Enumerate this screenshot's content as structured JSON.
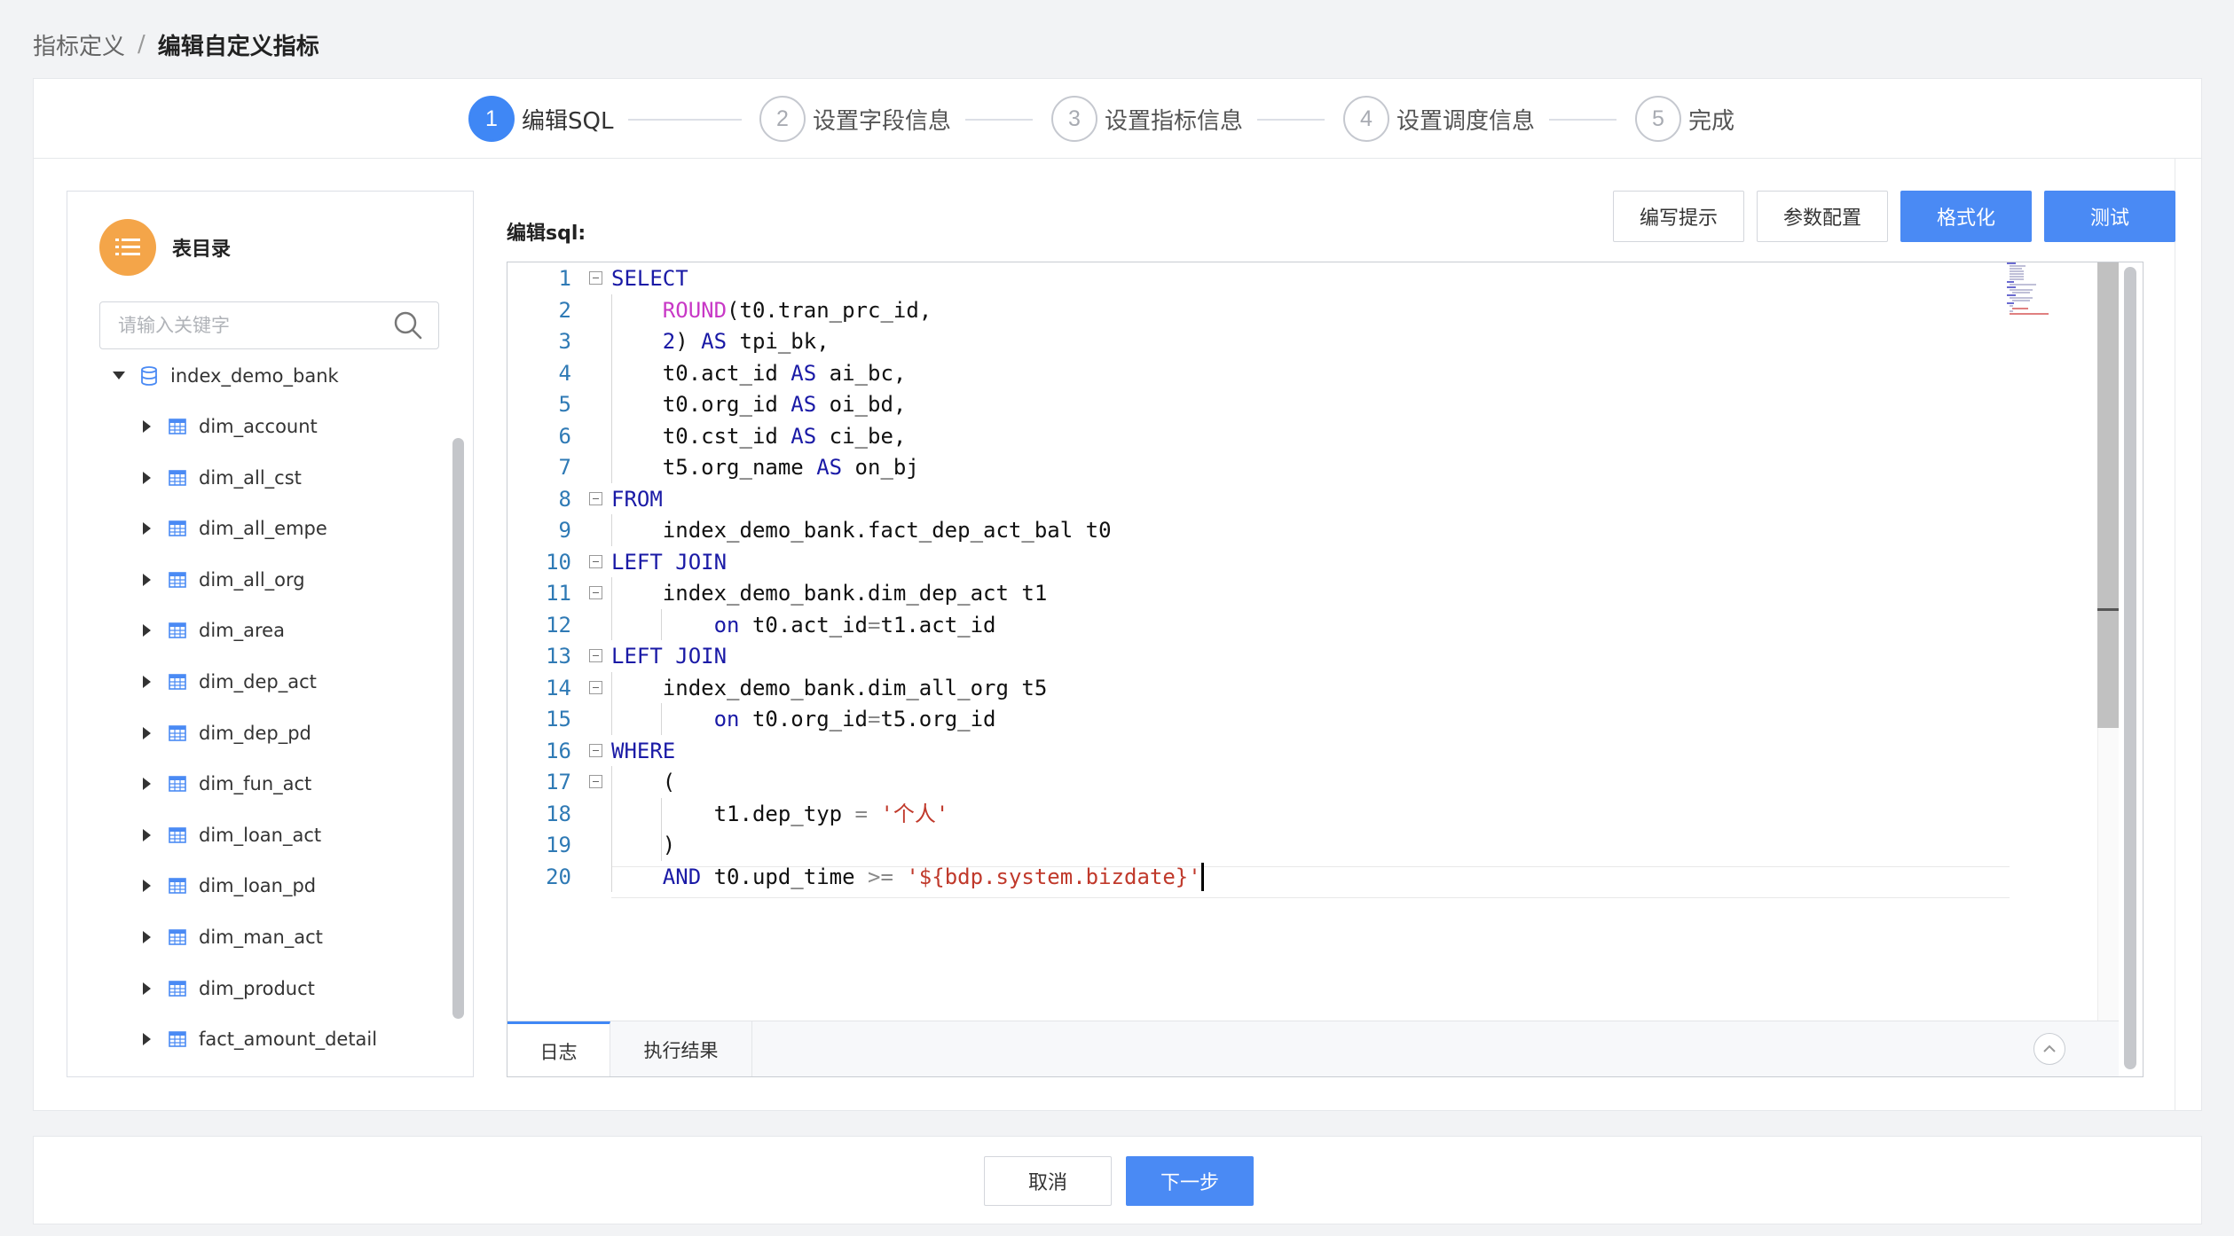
{
  "breadcrumb": {
    "parent": "指标定义",
    "separator": "/",
    "current": "编辑自定义指标"
  },
  "steps": [
    {
      "num": "1",
      "label": "编辑SQL",
      "active": true
    },
    {
      "num": "2",
      "label": "设置字段信息",
      "active": false
    },
    {
      "num": "3",
      "label": "设置指标信息",
      "active": false
    },
    {
      "num": "4",
      "label": "设置调度信息",
      "active": false
    },
    {
      "num": "5",
      "label": "完成",
      "active": false
    }
  ],
  "sidebar": {
    "title": "表目录",
    "icon": "list-icon",
    "search_placeholder": "请输入关键字",
    "database": "index_demo_bank",
    "tables": [
      "dim_account",
      "dim_all_cst",
      "dim_all_empe",
      "dim_all_org",
      "dim_area",
      "dim_dep_act",
      "dim_dep_pd",
      "dim_fun_act",
      "dim_loan_act",
      "dim_loan_pd",
      "dim_man_act",
      "dim_product",
      "fact_amount_detail"
    ]
  },
  "editor": {
    "label": "编辑sql:",
    "buttons": {
      "hint": "编写提示",
      "params": "参数配置",
      "format": "格式化",
      "test": "测试"
    },
    "line_numbers": [
      "1",
      "2",
      "3",
      "4",
      "5",
      "6",
      "7",
      "8",
      "9",
      "10",
      "11",
      "12",
      "13",
      "14",
      "15",
      "16",
      "17",
      "18",
      "19",
      "20"
    ],
    "code": [
      "SELECT",
      "    ROUND(t0.tran_prc_id,",
      "    2) AS tpi_bk,",
      "    t0.act_id AS ai_bc,",
      "    t0.org_id AS oi_bd,",
      "    t0.cst_id AS ci_be,",
      "    t5.org_name AS on_bj",
      "FROM",
      "    index_demo_bank.fact_dep_act_bal t0",
      "LEFT JOIN",
      "    index_demo_bank.dim_dep_act t1",
      "        on t0.act_id=t1.act_id",
      "LEFT JOIN",
      "    index_demo_bank.dim_all_org t5",
      "        on t0.org_id=t5.org_id",
      "WHERE",
      "    (",
      "        t1.dep_typ = '个人'",
      "    )",
      "    AND t0.upd_time >= '${bdp.system.bizdate}'"
    ],
    "result_tabs": [
      "日志",
      "执行结果"
    ]
  },
  "footer": {
    "cancel": "取消",
    "next": "下一步"
  },
  "colors": {
    "primary": "#4a8af4",
    "keyword": "#1a1aa6",
    "function": "#c838c6",
    "string": "#c0392b",
    "catalog_badge": "#f4a549"
  }
}
